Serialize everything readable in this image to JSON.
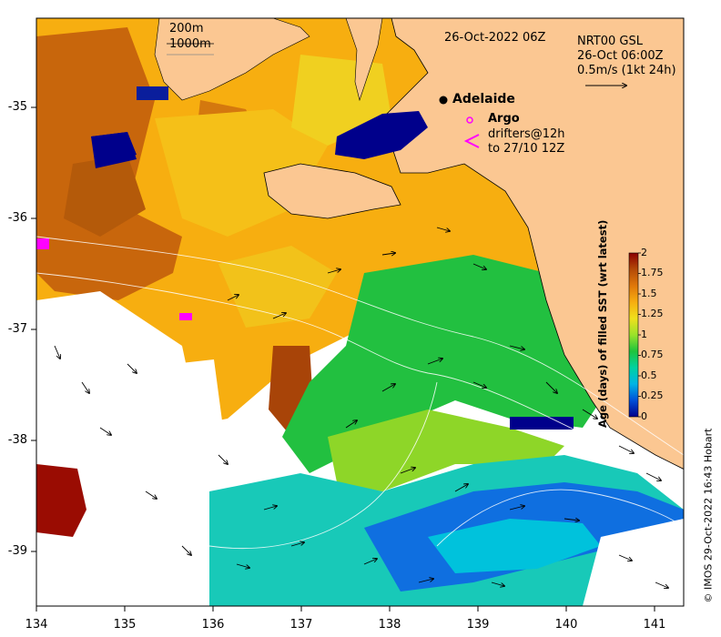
{
  "map": {
    "date_title": "26-Oct-2022 06Z",
    "isobath_labels": [
      "200m",
      "1000m"
    ],
    "legend_current": {
      "line1": "NRT00 GSL",
      "line2": "26-Oct 06:00Z",
      "line3": "0.5m/s (1kt 24h)"
    },
    "city": "Adelaide",
    "argo_label": "Argo",
    "drifters_line1": "drifters@12h",
    "drifters_line2": "to 27/10 12Z",
    "x_ticks": [
      "134",
      "135",
      "136",
      "137",
      "138",
      "139",
      "140",
      "141"
    ],
    "y_ticks": [
      "-35",
      "-36",
      "-37",
      "-38",
      "-39"
    ],
    "credit": "© IMOS 29-Oct-2022 16:43 Hobart",
    "colors": {
      "land": "#fbc792",
      "no_data": "#ffffff",
      "argo": "#ff00ff",
      "drifters": "#ff00ff"
    }
  },
  "colorbar": {
    "title": "Age (days) of filled SST (wrt latest)",
    "ticks": [
      "2",
      "1.75",
      "1.5",
      "1.25",
      "1",
      "0.75",
      "0.5",
      "0.25",
      "0"
    ],
    "range": [
      0,
      2
    ],
    "colormap": [
      "#00008b",
      "#0050d8",
      "#00b4e6",
      "#00d2a0",
      "#1ec43c",
      "#9ae22a",
      "#f0e01c",
      "#f7ae10",
      "#e0780a",
      "#b44a08",
      "#8b0000"
    ]
  }
}
